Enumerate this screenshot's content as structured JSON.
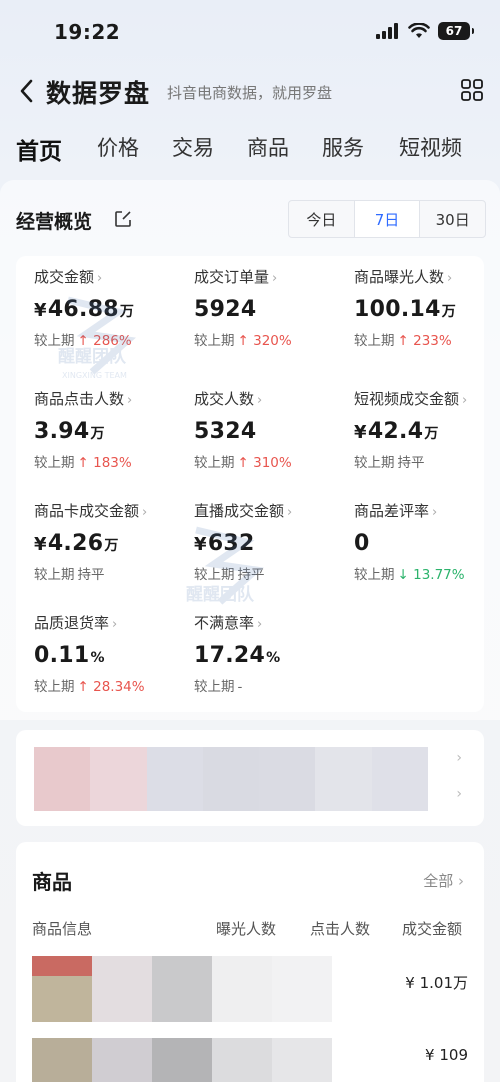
{
  "status_bar": {
    "time": "19:22",
    "battery": "67"
  },
  "nav": {
    "title": "数据罗盘",
    "subtitle": "抖音电商数据，就用罗盘"
  },
  "tabs": [
    "首页",
    "价格",
    "交易",
    "商品",
    "服务",
    "短视频"
  ],
  "overview": {
    "title": "经营概览",
    "ranges": [
      "今日",
      "7日",
      "30日"
    ],
    "active_range": "7日",
    "compare_label": "较上期",
    "metrics": [
      {
        "label": "成交金额",
        "currency": "¥",
        "value": "46.88",
        "unit": "万",
        "change": "286%",
        "trend": "up"
      },
      {
        "label": "成交订单量",
        "currency": "",
        "value": "5924",
        "unit": "",
        "change": "320%",
        "trend": "up"
      },
      {
        "label": "商品曝光人数",
        "currency": "",
        "value": "100.14",
        "unit": "万",
        "change": "233%",
        "trend": "up"
      },
      {
        "label": "商品点击人数",
        "currency": "",
        "value": "3.94",
        "unit": "万",
        "change": "183%",
        "trend": "up"
      },
      {
        "label": "成交人数",
        "currency": "",
        "value": "5324",
        "unit": "",
        "change": "310%",
        "trend": "up"
      },
      {
        "label": "短视频成交金额",
        "currency": "¥",
        "value": "42.4",
        "unit": "万",
        "change": "持平",
        "trend": "flat"
      },
      {
        "label": "商品卡成交金额",
        "currency": "¥",
        "value": "4.26",
        "unit": "万",
        "change": "持平",
        "trend": "flat"
      },
      {
        "label": "直播成交金额",
        "currency": "¥",
        "value": "632",
        "unit": "",
        "change": "持平",
        "trend": "flat"
      },
      {
        "label": "商品差评率",
        "currency": "",
        "value": "0",
        "unit": "",
        "change": "13.77%",
        "trend": "down"
      },
      {
        "label": "品质退货率",
        "currency": "",
        "value": "0.11",
        "unit": "%",
        "change": "28.34%",
        "trend": "up"
      },
      {
        "label": "不满意率",
        "currency": "",
        "value": "17.24",
        "unit": "%",
        "change": "-",
        "trend": "flat"
      }
    ],
    "watermark": {
      "text": "醒醒团队",
      "subtext": "XINGXING TEAM"
    }
  },
  "products": {
    "title": "商品",
    "all_label": "全部",
    "columns": [
      "商品信息",
      "曝光人数",
      "点击人数",
      "成交金额"
    ],
    "rows": [
      {
        "amount": "¥ 1.01万"
      },
      {
        "amount": "¥ 109"
      }
    ]
  },
  "colors": {
    "accent": "#2f6bff",
    "up": "#e8554e",
    "down": "#2cb36c"
  }
}
